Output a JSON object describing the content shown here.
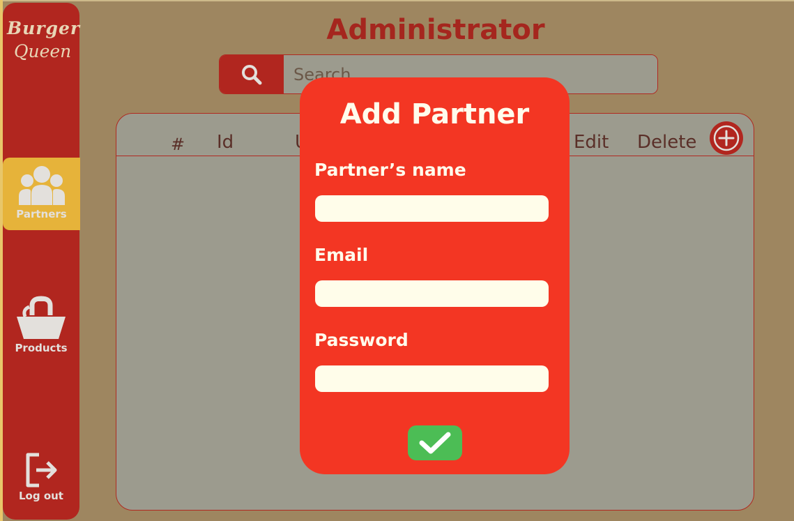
{
  "sidebar": {
    "logo_line1": "Burger",
    "logo_line2": "Queen",
    "items": [
      {
        "label": "Partners",
        "icon": "users-icon",
        "active": true
      },
      {
        "label": "Products",
        "icon": "basket-icon",
        "active": false
      },
      {
        "label": "Log out",
        "icon": "logout-icon",
        "active": false
      }
    ]
  },
  "header": {
    "title": "Administrator",
    "search": {
      "placeholder": "Search",
      "icon": "search-icon"
    }
  },
  "table": {
    "columns": [
      "#",
      "Id",
      "U",
      "Edit",
      "Delete"
    ],
    "add_icon": "plus-circle-icon",
    "rows": []
  },
  "modal": {
    "title": "Add Partner",
    "fields": [
      {
        "label": "Partner’s name",
        "value": ""
      },
      {
        "label": "Email",
        "value": ""
      },
      {
        "label": "Password",
        "value": ""
      }
    ],
    "confirm_icon": "checkmark-icon"
  },
  "colors": {
    "background": "#9e8660",
    "sidebar": "#b1261f",
    "active_item": "#e6b33a",
    "modal": "#f33623",
    "confirm": "#4cbd55",
    "panel": "#9c9b8e",
    "title": "#a5261e"
  }
}
